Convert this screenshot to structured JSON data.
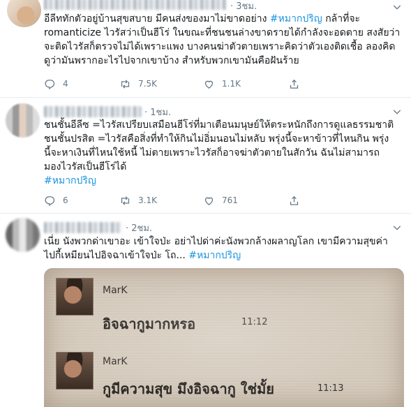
{
  "tweets": [
    {
      "time": "3ชม.",
      "lines": [
        "อีลีททักตัวอยู่บ้านสุขสบาย มีคนส่งของมาไม่ขาดอย่าง ",
        "romanticize ไวรัสว่าเป็นฮีโร่ ในขณะที่ชนชนล่างขาดรายได้กำลังจะอดตาย สงสัยว่า",
        "จะติดไวรัสก็ตรวจไม่ได้เพราะแพง บางคนฆ่าตัวตายเพราะคิดว่าตัวเองติดเชื้อ ลองคิด",
        "ดูว่ามันพรากอะไรไปจากเขาบ้าง สำหรับพวกเขามันคือฝันร้าย"
      ],
      "hashtag": "#หมากปริญ",
      "hashtag_suffix": " กล้าที่จะ",
      "replies": "4",
      "retweets": "7.5K",
      "likes": "1.1K"
    },
    {
      "time": "1ชม.",
      "lines": [
        "ชนชั้นอีลีซ =ไวรัสเปรียบเสมือนฮีโร่ที่มาเตือนมนุษย์ให้ตระหนักถึงการดูแลธรรมชาติ",
        "ชนชั้นปรสิต =ไวรัสคือสิ่งที่ทำให้กินไม่อิ่มนอนไม่หลับ พรุ่งนี้จะหาข้าวที่ไหนกิน พรุ่ง",
        "นี้จะหาเงินที่ไหนใช้หนี้ ไม่ตายเพราะไวรัสก็อาจฆ่าตัวตายในสักวัน  ฉันไม่สามารถ",
        "มองไวรัสเป็นฮีโร่ได้"
      ],
      "hashtag": "#หมากปริญ",
      "replies": "6",
      "retweets": "3.1K",
      "likes": "761"
    },
    {
      "time": "2ชม.",
      "lines": [
        "เนี่ย นังพวกด่าเขาอะ เข้าใจป่ะ อย่าไปด่าค่ะนังพวกล้างผลาญโลก เขามีความสุขค่า",
        "ไปกี้เหมียนไปอิจฉาเข้าใจป่ะ โถ... "
      ],
      "hashtag": "#หมากปริญ",
      "media": {
        "messages": [
          {
            "name": "MarK",
            "text": "อิจฉากูมากหรอ",
            "time": "11:12"
          },
          {
            "name": "MarK",
            "text": "กูมีความสุข มึงอิจฉากู ใช่มั้ย",
            "time": "11:13"
          }
        ]
      }
    }
  ],
  "icons": {
    "reply": "reply-icon",
    "retweet": "retweet-icon",
    "like": "heart-icon",
    "share": "share-icon",
    "more": "chevron-down-icon"
  },
  "colors": {
    "hashtag": "#1b95e0",
    "meta": "#657786",
    "divider": "#e6ecf0"
  }
}
